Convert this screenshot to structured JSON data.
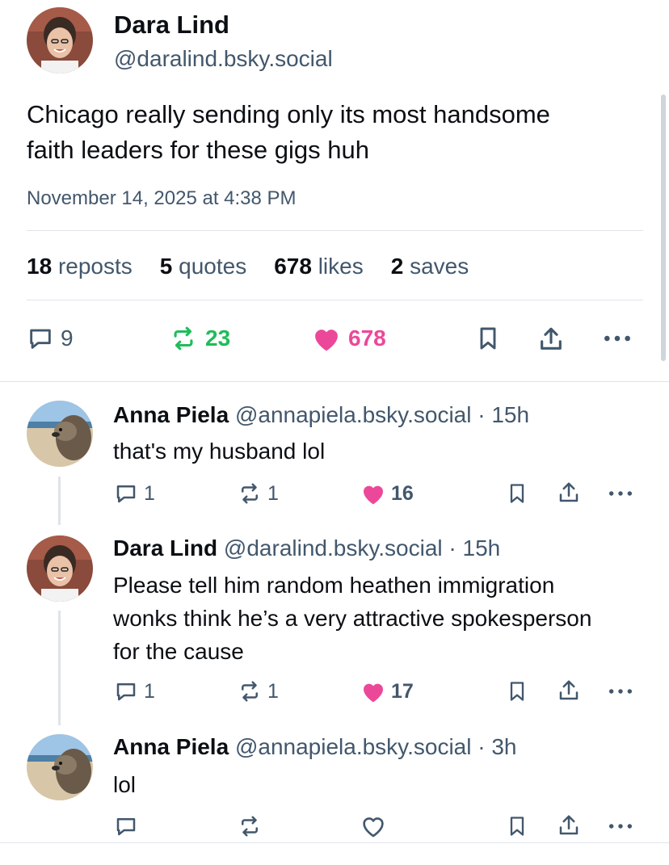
{
  "main": {
    "author_name": "Dara Lind",
    "author_handle": "@daralind.bsky.social",
    "text_line1": "Chicago really sending only its most handsome",
    "text_line2": "faith leaders for these gigs huh",
    "date": "November 14, 2025 at 4:38 PM",
    "stats": {
      "reposts_num": "18",
      "reposts_label": "reposts",
      "quotes_num": "5",
      "quotes_label": "quotes",
      "likes_num": "678",
      "likes_label": "likes",
      "saves_num": "2",
      "saves_label": "saves"
    },
    "actions": {
      "replies": "9",
      "reposts": "23",
      "likes": "678"
    }
  },
  "replies": [
    {
      "name": "Anna Piela",
      "meta": "@annapiela.bsky.social · 15h",
      "text": "that's my husband lol",
      "replies": "1",
      "reposts": "1",
      "likes": "16"
    },
    {
      "name": "Dara Lind",
      "meta": "@daralind.bsky.social · 15h",
      "text": "Please tell him random heathen immigration wonks think he’s a very attractive spokesperson for the cause",
      "replies": "1",
      "reposts": "1",
      "likes": "17"
    },
    {
      "name": "Anna Piela",
      "meta": "@annapiela.bsky.social · 3h",
      "text": "lol",
      "replies": "",
      "reposts": "",
      "likes": ""
    }
  ],
  "colors": {
    "accent_like": "#ec4899",
    "accent_repost": "#20bc5a",
    "muted": "#42576c"
  },
  "icons": [
    "reply-icon",
    "repost-icon",
    "heart-icon",
    "bookmark-icon",
    "share-icon",
    "more-icon"
  ]
}
